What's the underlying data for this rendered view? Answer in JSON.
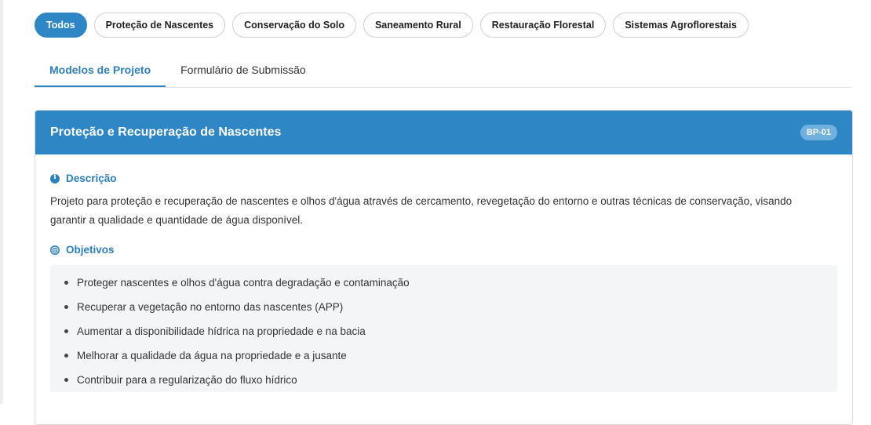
{
  "filters": [
    "Todos",
    "Proteção de Nascentes",
    "Conservação do Solo",
    "Saneamento Rural",
    "Restauração Florestal",
    "Sistemas Agroflorestais"
  ],
  "active_filter": "Todos",
  "tabs": [
    "Modelos de Projeto",
    "Formulário de Submissão"
  ],
  "active_tab": "Modelos de Projeto",
  "card": {
    "title": "Proteção e Recuperação de Nascentes",
    "badge": "BP-01",
    "description_title": "Descrição",
    "description": "Projeto para proteção e recuperação de nascentes e olhos d'água através de cercamento, revegetação do entorno e outras técnicas de conservação, visando garantir a qualidade e quantidade de água disponível.",
    "objectives_title": "Objetivos",
    "objectives": [
      "Proteger nascentes e olhos d'água contra degradação e contaminação",
      "Recuperar a vegetação no entorno das nascentes (APP)",
      "Aumentar a disponibilidade hídrica na propriedade e na bacia",
      "Melhorar a qualidade da água na propriedade e a jusante",
      "Contribuir para a regularização do fluxo hídrico"
    ]
  },
  "colors": {
    "accent": "#2f86c4",
    "badge": "#6fb0de",
    "objectives_bg": "#f4f5f7"
  },
  "icons": [
    "info-icon",
    "target-icon"
  ]
}
